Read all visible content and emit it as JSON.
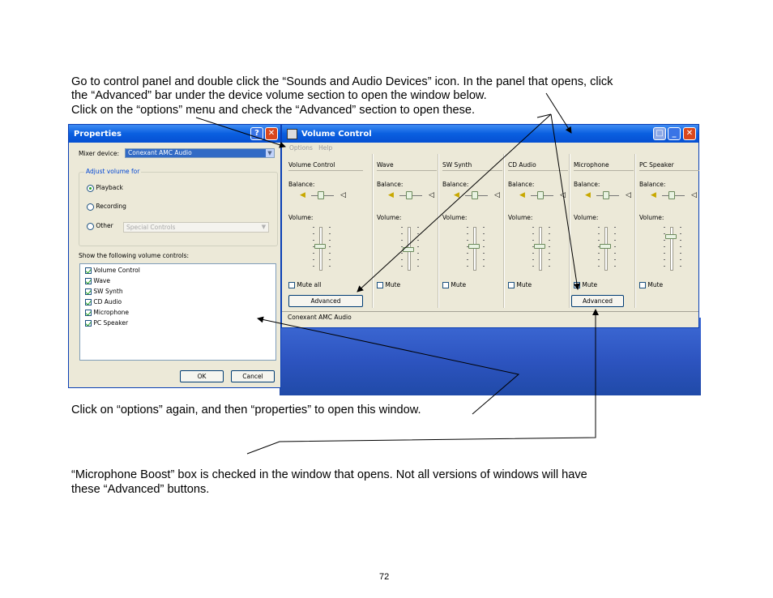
{
  "text": {
    "intro_line1": "Go to control panel and double click the “Sounds and Audio Devices” icon. In the panel that opens, click",
    "intro_line2": "the “Advanced” bar under the device volume section to open the window below.",
    "intro_line3": "Click on the “options” menu and check the “Advanced” section to open these.",
    "properties_note": "Click on “options” again, and then “properties” to open this window.",
    "boost_line1": "“Microphone Boost” box is checked in the window that opens. Not all versions of windows will have",
    "boost_line2": "these “Advanced” buttons.",
    "page_number": "72"
  },
  "properties_window": {
    "title": "Properties",
    "mixer_label": "Mixer device:",
    "mixer_value": "Conexant AMC Audio",
    "adjust_group": "Adjust volume for",
    "radio_playback": "Playback",
    "radio_recording": "Recording",
    "radio_other": "Other",
    "other_select": "Special Controls",
    "show_label": "Show the following volume controls:",
    "controls": [
      {
        "label": "Volume Control",
        "checked": true
      },
      {
        "label": "Wave",
        "checked": true
      },
      {
        "label": "SW Synth",
        "checked": true
      },
      {
        "label": "CD Audio",
        "checked": true
      },
      {
        "label": "Microphone",
        "checked": true
      },
      {
        "label": "PC Speaker",
        "checked": true
      }
    ],
    "ok": "OK",
    "cancel": "Cancel"
  },
  "volume_window": {
    "title": "Volume Control",
    "menu_options": "Options",
    "menu_help": "Help",
    "balance_label": "Balance:",
    "volume_label": "Volume:",
    "status": "Conexant AMC Audio",
    "columns": [
      {
        "name": "Volume Control",
        "mute": "Mute all",
        "advanced": "Advanced",
        "volume": 0.55
      },
      {
        "name": "Wave",
        "mute": "Mute",
        "advanced": "",
        "volume": 0.45
      },
      {
        "name": "SW Synth",
        "mute": "Mute",
        "advanced": "",
        "volume": 0.55
      },
      {
        "name": "CD Audio",
        "mute": "Mute",
        "advanced": "",
        "volume": 0.55
      },
      {
        "name": "Microphone",
        "mute": "Mute",
        "advanced": "Advanced",
        "volume": 0.55
      },
      {
        "name": "PC Speaker",
        "mute": "Mute",
        "advanced": "",
        "volume": 0.8
      }
    ]
  },
  "colors": {
    "title_blue": "#0a5fe0",
    "panel": "#ece9d8",
    "desktop": "#2d54c0"
  }
}
